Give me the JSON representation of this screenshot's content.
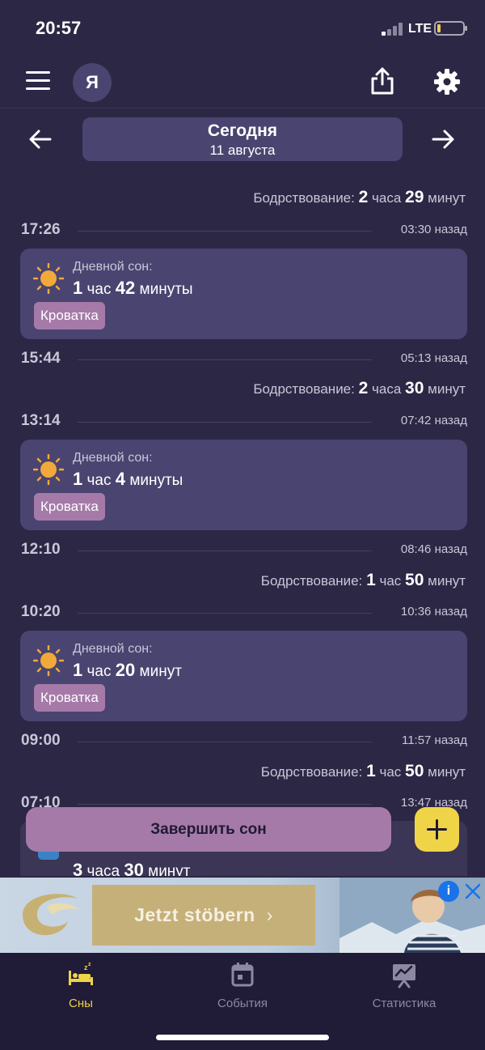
{
  "status_bar": {
    "time": "20:57",
    "network": "LTE"
  },
  "header": {
    "avatar_letter": "Я"
  },
  "date_nav": {
    "title": "Сегодня",
    "subtitle": "11 августа"
  },
  "timeline": {
    "wake_label": "Бодрствование:",
    "sleep_label": "Дневной сон:",
    "tag": "Кроватка",
    "entries": [
      {
        "wake": {
          "h": "2",
          "h_unit": "часа",
          "m": "29",
          "m_unit": "минут"
        }
      },
      {
        "time": "17:26",
        "ago": "03:30 назад"
      },
      {
        "sleep": {
          "h": "1",
          "h_unit": "час",
          "m": "42",
          "m_unit": "минуты"
        }
      },
      {
        "time": "15:44",
        "ago": "05:13 назад"
      },
      {
        "wake": {
          "h": "2",
          "h_unit": "часа",
          "m": "30",
          "m_unit": "минут"
        }
      },
      {
        "time": "13:14",
        "ago": "07:42 назад"
      },
      {
        "sleep": {
          "h": "1",
          "h_unit": "час",
          "m": "4",
          "m_unit": "минуты"
        }
      },
      {
        "time": "12:10",
        "ago": "08:46 назад"
      },
      {
        "wake": {
          "h": "1",
          "h_unit": "час",
          "m": "50",
          "m_unit": "минут"
        }
      },
      {
        "time": "10:20",
        "ago": "10:36 назад"
      },
      {
        "sleep": {
          "h": "1",
          "h_unit": "час",
          "m": "20",
          "m_unit": "минут"
        }
      },
      {
        "time": "09:00",
        "ago": "11:57 назад"
      },
      {
        "wake": {
          "h": "1",
          "h_unit": "час",
          "m": "50",
          "m_unit": "минут"
        }
      },
      {
        "time": "07:10",
        "ago": "13:47 назад"
      }
    ],
    "partial": {
      "h": "3",
      "h_unit": "часа",
      "m": "30",
      "m_unit": "минут"
    }
  },
  "actions": {
    "finish_sleep": "Завершить сон"
  },
  "ad": {
    "button": "Jetzt stöbern",
    "chevron": "›",
    "info": "i"
  },
  "tabs": [
    {
      "label": "Сны",
      "icon": "bed-icon",
      "active": true
    },
    {
      "label": "События",
      "icon": "calendar-icon",
      "active": false
    },
    {
      "label": "Статистика",
      "icon": "chart-icon",
      "active": false
    }
  ],
  "colors": {
    "background": "#2c2745",
    "card": "#4a4470",
    "tag": "#a57aa9",
    "accent": "#f0d448",
    "sun": "#f2a93b"
  }
}
